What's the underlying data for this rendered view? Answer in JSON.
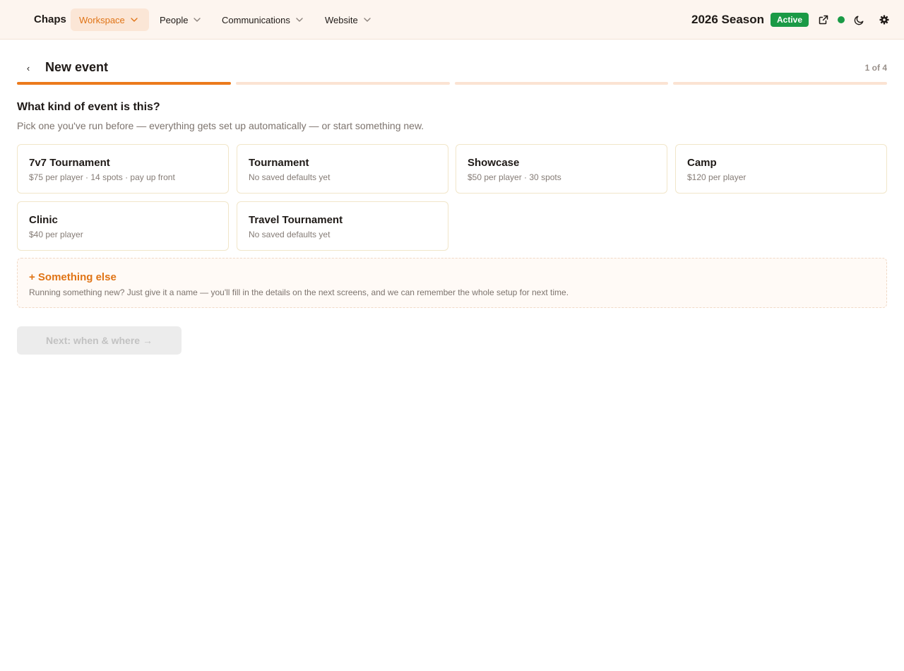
{
  "nav": {
    "brand": "Chaps",
    "items": [
      {
        "label": "Workspace"
      },
      {
        "label": "People"
      },
      {
        "label": "Communications"
      },
      {
        "label": "Website"
      }
    ],
    "season": "2026 Season",
    "season_status": "Active",
    "accent_color": "#e07416",
    "status_color": "#1a9a46",
    "icons": [
      "chevron-down-icon",
      "external-link-icon",
      "status-dot",
      "moon-icon",
      "gear-icon"
    ]
  },
  "header": {
    "back_label": "‹",
    "title": "New event",
    "step_text": "1 of 4",
    "current_step": 1,
    "total_steps": 4
  },
  "prompt": {
    "question": "What kind of event is this?",
    "hint": "Pick one you've run before — everything gets set up automatically — or start something new."
  },
  "templates": [
    {
      "title": "7v7 Tournament",
      "subtitle": "$75 per player · 14 spots · pay up front"
    },
    {
      "title": "Tournament",
      "subtitle": "No saved defaults yet"
    },
    {
      "title": "Showcase",
      "subtitle": "$50 per player · 30 spots"
    },
    {
      "title": "Camp",
      "subtitle": "$120 per player"
    },
    {
      "title": "Clinic",
      "subtitle": "$40 per player"
    },
    {
      "title": "Travel Tournament",
      "subtitle": "No saved defaults yet"
    }
  ],
  "something_else": {
    "title": "+ Something else",
    "description": "Running something new? Just give it a name — you'll fill in the details on the next screens, and we can remember the whole setup for next time."
  },
  "next_button": {
    "label": "Next: when & where →",
    "disabled": true
  }
}
